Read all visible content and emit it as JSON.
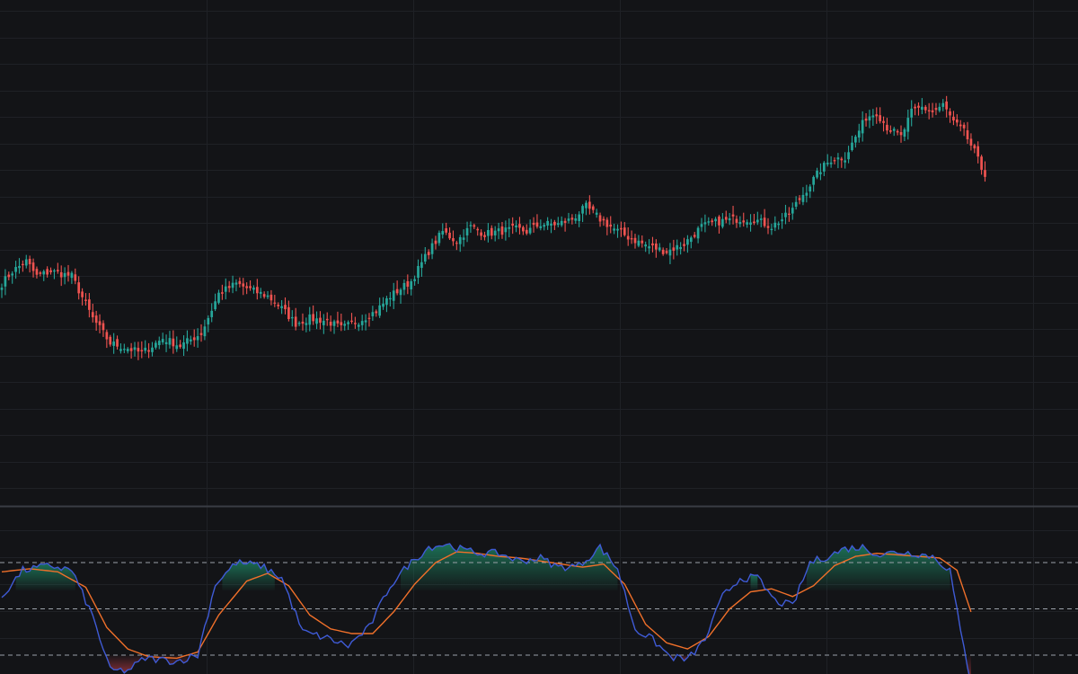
{
  "colors": {
    "background": "#131417",
    "grid": "#1f2126",
    "divider": "#3a3d44",
    "up": "#26a69a",
    "down": "#ef5350",
    "k_line": "#3f5bd6",
    "d_line": "#f0702a",
    "level_line": "#9aa0a8",
    "overbought_fill": "#1f8f6a",
    "oversold_fill": "#b53a44"
  },
  "chart_data": [
    {
      "type": "candlestick",
      "title": "",
      "xlabel": "",
      "ylabel": "",
      "ylim": [
        0,
        100
      ],
      "grid": true,
      "anchors": [
        [
          0,
          63,
          "down"
        ],
        [
          3,
          68,
          "up"
        ],
        [
          7,
          72,
          "down"
        ],
        [
          10,
          66,
          "down"
        ],
        [
          14,
          68,
          "up"
        ],
        [
          20,
          66,
          "down"
        ],
        [
          26,
          49,
          "down"
        ],
        [
          31,
          39,
          "down"
        ],
        [
          36,
          37,
          "up"
        ],
        [
          40,
          35,
          "up"
        ],
        [
          46,
          41,
          "down"
        ],
        [
          51,
          38,
          "down"
        ],
        [
          57,
          43,
          "up"
        ],
        [
          62,
          59,
          "up"
        ],
        [
          67,
          63,
          "down"
        ],
        [
          72,
          60,
          "up"
        ],
        [
          76,
          58,
          "up"
        ],
        [
          80,
          53,
          "down"
        ],
        [
          84,
          47,
          "down"
        ],
        [
          88,
          49,
          "up"
        ],
        [
          93,
          48,
          "down"
        ],
        [
          97,
          45,
          "down"
        ],
        [
          102,
          48,
          "up"
        ],
        [
          107,
          52,
          "up"
        ],
        [
          111,
          58,
          "up"
        ],
        [
          117,
          64,
          "up"
        ],
        [
          122,
          76,
          "up"
        ],
        [
          126,
          84,
          "down"
        ],
        [
          130,
          80,
          "up"
        ],
        [
          134,
          86,
          "up"
        ],
        [
          138,
          83,
          "down"
        ],
        [
          142,
          84,
          "up"
        ],
        [
          147,
          85,
          "up"
        ],
        [
          150,
          84,
          "down"
        ],
        [
          154,
          87,
          "up"
        ],
        [
          159,
          87,
          "up"
        ],
        [
          163,
          89,
          "up"
        ],
        [
          167,
          94,
          "up"
        ],
        [
          171,
          89,
          "down"
        ],
        [
          175,
          85,
          "down"
        ],
        [
          180,
          81,
          "down"
        ],
        [
          185,
          78,
          "down"
        ],
        [
          190,
          76,
          "down"
        ],
        [
          195,
          79,
          "up"
        ],
        [
          200,
          86,
          "up"
        ],
        [
          205,
          88,
          "up"
        ],
        [
          210,
          89,
          "up"
        ],
        [
          215,
          89,
          "down"
        ],
        [
          220,
          86,
          "up"
        ],
        [
          225,
          91,
          "up"
        ],
        [
          230,
          101,
          "up"
        ],
        [
          234,
          109,
          "up"
        ],
        [
          237,
          113,
          "down"
        ],
        [
          241,
          114,
          "up"
        ],
        [
          244,
          122,
          "up"
        ],
        [
          247,
          130,
          "up"
        ],
        [
          250,
          132,
          "down"
        ],
        [
          253,
          126,
          "down"
        ],
        [
          257,
          122,
          "up"
        ],
        [
          260,
          132,
          "up"
        ],
        [
          263,
          134,
          "down"
        ],
        [
          266,
          132,
          "up"
        ],
        [
          269,
          135,
          "up"
        ],
        [
          272,
          128,
          "down"
        ],
        [
          275,
          124,
          "down"
        ],
        [
          278,
          116,
          "down"
        ],
        [
          281,
          106,
          "down"
        ]
      ]
    },
    {
      "type": "line",
      "title": "",
      "ylim": [
        0,
        100
      ],
      "levels": [
        80,
        50,
        20
      ],
      "series": [
        {
          "key": "k",
          "points": [
            [
              0,
              58
            ],
            [
              6,
              75
            ],
            [
              14,
              78
            ],
            [
              20,
              75
            ],
            [
              26,
              45
            ],
            [
              31,
              10
            ],
            [
              36,
              10
            ],
            [
              41,
              18
            ],
            [
              50,
              16
            ],
            [
              56,
              20
            ],
            [
              61,
              66
            ],
            [
              67,
              80
            ],
            [
              74,
              78
            ],
            [
              80,
              70
            ],
            [
              86,
              35
            ],
            [
              93,
              31
            ],
            [
              99,
              26
            ],
            [
              105,
              38
            ],
            [
              111,
              65
            ],
            [
              116,
              78
            ],
            [
              122,
              90
            ],
            [
              127,
              92
            ],
            [
              132,
              88
            ],
            [
              137,
              86
            ],
            [
              142,
              86
            ],
            [
              148,
              81
            ],
            [
              154,
              83
            ],
            [
              159,
              77
            ],
            [
              165,
              78
            ],
            [
              171,
              90
            ],
            [
              176,
              76
            ],
            [
              181,
              37
            ],
            [
              186,
              30
            ],
            [
              191,
              19
            ],
            [
              196,
              17
            ],
            [
              201,
              30
            ],
            [
              206,
              58
            ],
            [
              211,
              70
            ],
            [
              216,
              70
            ],
            [
              221,
              55
            ],
            [
              226,
              52
            ],
            [
              231,
              80
            ],
            [
              236,
              84
            ],
            [
              241,
              89
            ],
            [
              246,
              90
            ],
            [
              251,
              85
            ],
            [
              256,
              87
            ],
            [
              261,
              86
            ],
            [
              266,
              84
            ],
            [
              271,
              75
            ],
            [
              274,
              35
            ],
            [
              277,
              3
            ]
          ]
        },
        {
          "key": "d",
          "points": [
            [
              0,
              74
            ],
            [
              8,
              76
            ],
            [
              16,
              74
            ],
            [
              24,
              64
            ],
            [
              30,
              38
            ],
            [
              36,
              24
            ],
            [
              42,
              19
            ],
            [
              50,
              18
            ],
            [
              56,
              22
            ],
            [
              62,
              46
            ],
            [
              70,
              68
            ],
            [
              76,
              73
            ],
            [
              82,
              65
            ],
            [
              88,
              46
            ],
            [
              94,
              37
            ],
            [
              100,
              34
            ],
            [
              106,
              34
            ],
            [
              112,
              48
            ],
            [
              118,
              66
            ],
            [
              124,
              80
            ],
            [
              130,
              87
            ],
            [
              136,
              86
            ],
            [
              142,
              84
            ],
            [
              148,
              83
            ],
            [
              154,
              81
            ],
            [
              160,
              79
            ],
            [
              166,
              77
            ],
            [
              172,
              79
            ],
            [
              178,
              66
            ],
            [
              184,
              40
            ],
            [
              190,
              28
            ],
            [
              196,
              24
            ],
            [
              202,
              32
            ],
            [
              208,
              50
            ],
            [
              214,
              61
            ],
            [
              220,
              63
            ],
            [
              226,
              58
            ],
            [
              232,
              65
            ],
            [
              238,
              78
            ],
            [
              244,
              84
            ],
            [
              250,
              86
            ],
            [
              256,
              85
            ],
            [
              262,
              84
            ],
            [
              268,
              83
            ],
            [
              273,
              75
            ],
            [
              277,
              48
            ]
          ]
        }
      ]
    }
  ]
}
